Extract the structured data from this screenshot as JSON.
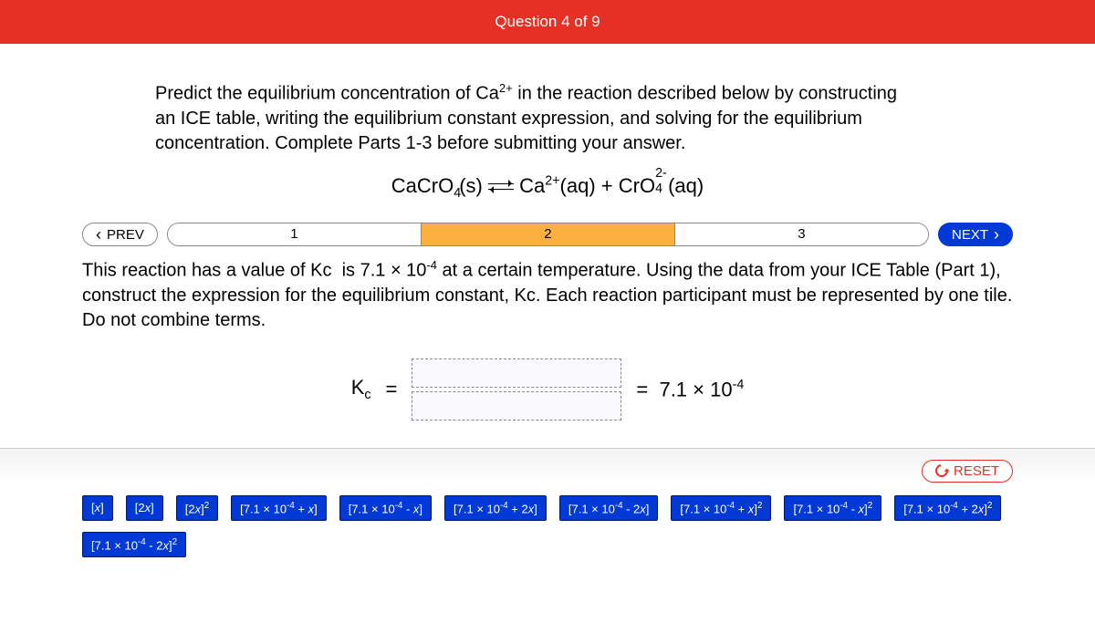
{
  "header": {
    "title": "Question 4 of 9"
  },
  "prompt": "Predict the equilibrium concentration of Ca²⁺ in the reaction described below by constructing an ICE table, writing the equilibrium constant expression, and solving for the equilibrium concentration. Complete Parts 1-3 before submitting your answer.",
  "equation": {
    "lhs": "CaCrO₄(s)",
    "rhs1": "Ca²⁺(aq)",
    "rhs2": "CrO₄²⁻(aq)"
  },
  "nav": {
    "prev": "PREV",
    "next": "NEXT",
    "steps": [
      "1",
      "2",
      "3"
    ],
    "active": 1
  },
  "instructions": "This reaction has a value of Kc  is 7.1 × 10⁻⁴ at a certain temperature. Using the data from your ICE Table (Part 1), construct the expression for the equilibrium constant, Kc. Each reaction participant must be represented by one tile. Do not combine terms.",
  "kc": {
    "label": "Kc",
    "equals": "=",
    "value_prefix": "=  7.1 × 10",
    "value_exp": "-4"
  },
  "reset": "RESET",
  "tiles": [
    "[x]",
    "[2x]",
    "[2x]²",
    "[7.1 × 10⁻⁴ + x]",
    "[7.1 × 10⁻⁴ - x]",
    "[7.1 × 10⁻⁴ + 2x]",
    "[7.1 × 10⁻⁴ - 2x]",
    "[7.1 × 10⁻⁴ + x]²",
    "[7.1 × 10⁻⁴ - x]²",
    "[7.1 × 10⁻⁴ + 2x]²",
    "[7.1 × 10⁻⁴ - 2x]²"
  ]
}
